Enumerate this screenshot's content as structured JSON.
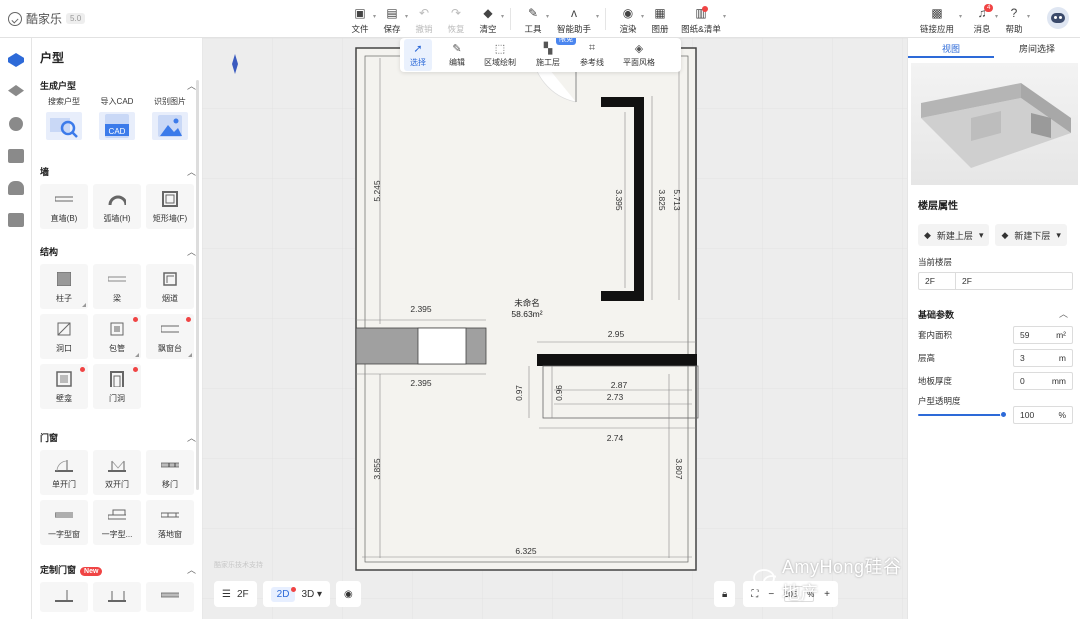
{
  "app": {
    "name": "酷家乐",
    "version": "5.0"
  },
  "toolbar": {
    "left": [
      {
        "label": "文件",
        "icon": "file-icon"
      },
      {
        "label": "保存",
        "icon": "save-icon"
      },
      {
        "label": "撤销",
        "icon": "undo-icon"
      },
      {
        "label": "恢复",
        "icon": "redo-icon"
      },
      {
        "label": "清空",
        "icon": "eraser-icon"
      }
    ],
    "middle": [
      {
        "label": "工具",
        "icon": "wrench-icon"
      },
      {
        "label": "智能助手",
        "icon": "ai-assistant-icon"
      },
      {
        "label": "渲染",
        "icon": "camera-icon"
      },
      {
        "label": "图册",
        "icon": "album-icon"
      },
      {
        "label": "图纸&清单",
        "icon": "drawing-list-icon"
      }
    ],
    "right": [
      {
        "label": "链接应用",
        "icon": "app-link-icon"
      },
      {
        "label": "消息",
        "icon": "bell-icon",
        "badge": "4"
      },
      {
        "label": "帮助",
        "icon": "help-icon"
      }
    ]
  },
  "left_panel": {
    "title": "户型",
    "sections": [
      {
        "title": "生成户型",
        "items": [
          "搜索户型",
          "导入CAD",
          "识别图片"
        ]
      },
      {
        "title": "墙",
        "items": [
          "直墙(B)",
          "弧墙(H)",
          "矩形墙(F)"
        ]
      },
      {
        "title": "结构",
        "items": [
          "柱子",
          "梁",
          "烟道",
          "洞口",
          "包管",
          "飘窗台",
          "壁龛",
          "门洞"
        ]
      },
      {
        "title": "门窗",
        "items": [
          "单开门",
          "双开门",
          "移门",
          "一字型窗",
          "一字型...",
          "落地窗"
        ]
      },
      {
        "title": "定制门窗",
        "badge": "New"
      }
    ],
    "cad_label": "CAD"
  },
  "draw_toolbar": {
    "items": [
      "选择",
      "编辑",
      "区域绘制",
      "施工层",
      "参考线",
      "平面风格"
    ],
    "limit_tag": "限免"
  },
  "floorplan": {
    "room_name": "未命名",
    "room_area": "58.63m²",
    "dims": {
      "left_upper": "5.245",
      "left_lower": "3.855",
      "bottom": "6.325",
      "right_lower": "3.807",
      "wall_inner": "3.395",
      "wall_mid": "3.825",
      "wall_outer": "5.713",
      "opening_top": "2.395",
      "opening_bottom": "2.395",
      "shelf_top": "2.95",
      "shelf_a": "2.87",
      "shelf_b": "2.73",
      "shelf_bottom": "2.74",
      "shelf_h1": "0.97",
      "shelf_h2": "0.96"
    }
  },
  "bottom_bar": {
    "floor": "2F",
    "mode_2d": "2D",
    "mode_3d": "3D",
    "zoom": "105",
    "zoom_unit": "%",
    "small_text": "酷家乐技术支持"
  },
  "watermark": "AmyHong硅谷地产",
  "right_panel": {
    "tabs": [
      "视图",
      "房间选择"
    ],
    "floor_props_title": "楼层属性",
    "new_upper": "新建上层",
    "new_lower": "新建下层",
    "current_floor_label": "当前楼层",
    "floor_code": "2F",
    "floor_name": "2F",
    "params_title": "基础参数",
    "params": [
      {
        "label": "套内面积",
        "value": "59",
        "unit": "m²"
      },
      {
        "label": "层高",
        "value": "3",
        "unit": "m"
      },
      {
        "label": "地板厚度",
        "value": "0",
        "unit": "mm"
      }
    ],
    "transparency_label": "户型透明度",
    "transparency_value": "100",
    "transparency_unit": "%",
    "accent": "#2d6ad8"
  }
}
